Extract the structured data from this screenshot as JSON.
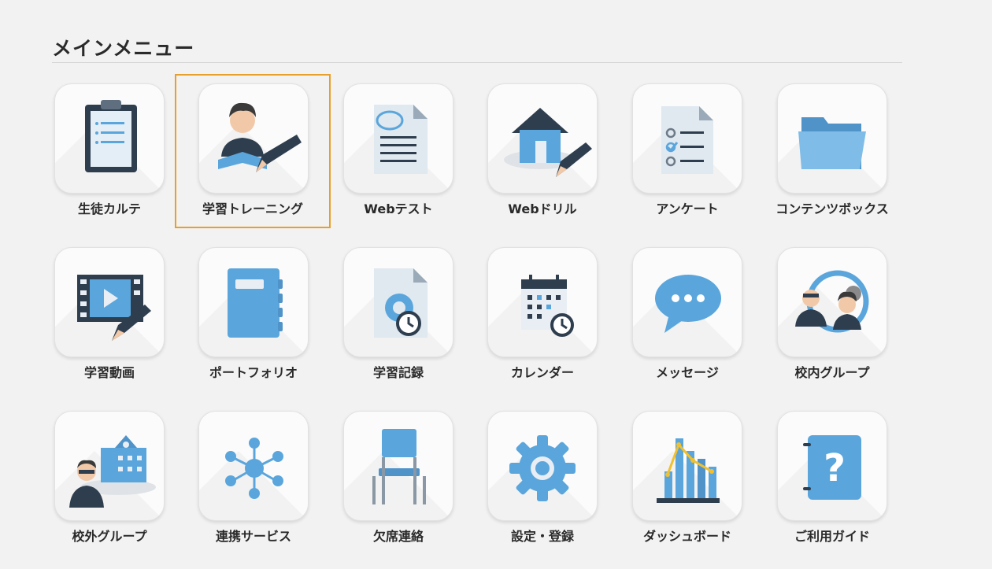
{
  "header": {
    "title": "メインメニュー"
  },
  "menu": {
    "items": [
      {
        "label": "生徒カルテ",
        "icon": "clipboard-icon"
      },
      {
        "label": "学習トレーニング",
        "icon": "student-pencil-icon",
        "selected": true
      },
      {
        "label": "Webテスト",
        "icon": "test-paper-icon"
      },
      {
        "label": "Webドリル",
        "icon": "house-pencil-icon"
      },
      {
        "label": "アンケート",
        "icon": "checklist-icon"
      },
      {
        "label": "コンテンツボックス",
        "icon": "folder-icon"
      },
      {
        "label": "学習動画",
        "icon": "film-pencil-icon"
      },
      {
        "label": "ポートフォリオ",
        "icon": "notebook-icon"
      },
      {
        "label": "学習記録",
        "icon": "record-clock-icon"
      },
      {
        "label": "カレンダー",
        "icon": "calendar-icon"
      },
      {
        "label": "メッセージ",
        "icon": "chat-bubble-icon"
      },
      {
        "label": "校内グループ",
        "icon": "group-icon"
      },
      {
        "label": "校外グループ",
        "icon": "school-group-icon"
      },
      {
        "label": "連携サービス",
        "icon": "network-icon"
      },
      {
        "label": "欠席連絡",
        "icon": "chair-icon"
      },
      {
        "label": "設定・登録",
        "icon": "gear-icon"
      },
      {
        "label": "ダッシュボード",
        "icon": "dashboard-chart-icon"
      },
      {
        "label": "ご利用ガイド",
        "icon": "guide-book-icon"
      }
    ]
  },
  "colors": {
    "accent": "#e8a02c",
    "icon_blue": "#5aa6dc",
    "icon_dark": "#2f3e4e"
  }
}
